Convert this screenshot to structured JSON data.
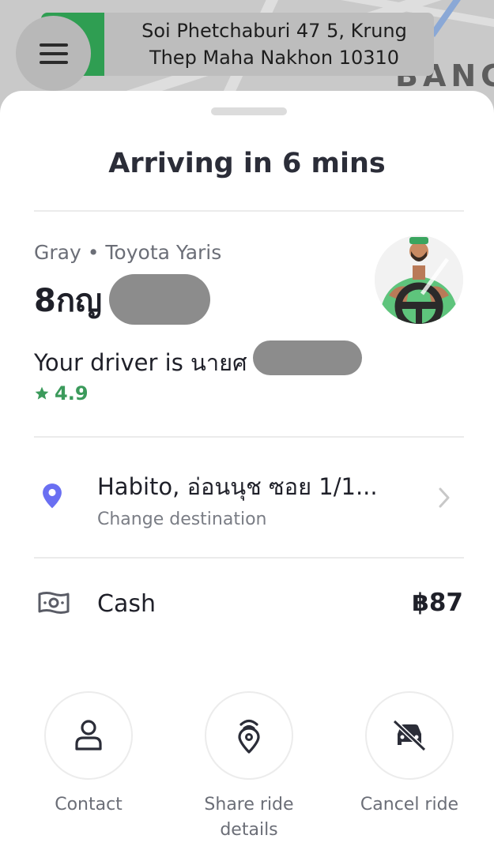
{
  "map": {
    "address_line1": "Soi Phetchaburi 47 5, Krung",
    "address_line2": "Thep Maha Nakhon 10310",
    "area_label": "BANG"
  },
  "sheet": {
    "title": "Arriving in 6 mins"
  },
  "driver": {
    "vehicle": "Gray • Toyota Yaris",
    "plate_visible": "8กญ",
    "driver_text": "Your driver is นายศ",
    "rating": "4.9",
    "rating_color": "#3b9a5b"
  },
  "destination": {
    "title": "Habito, อ่อนนุช ซอย 1/1...",
    "action": "Change destination",
    "pin_color": "#6a6ff2"
  },
  "payment": {
    "method": "Cash",
    "amount": "฿87"
  },
  "actions": [
    {
      "label": "Contact",
      "icon": "person-icon"
    },
    {
      "label": "Share ride details",
      "icon": "share-location-icon"
    },
    {
      "label": "Cancel ride",
      "icon": "cancel-car-icon"
    }
  ]
}
